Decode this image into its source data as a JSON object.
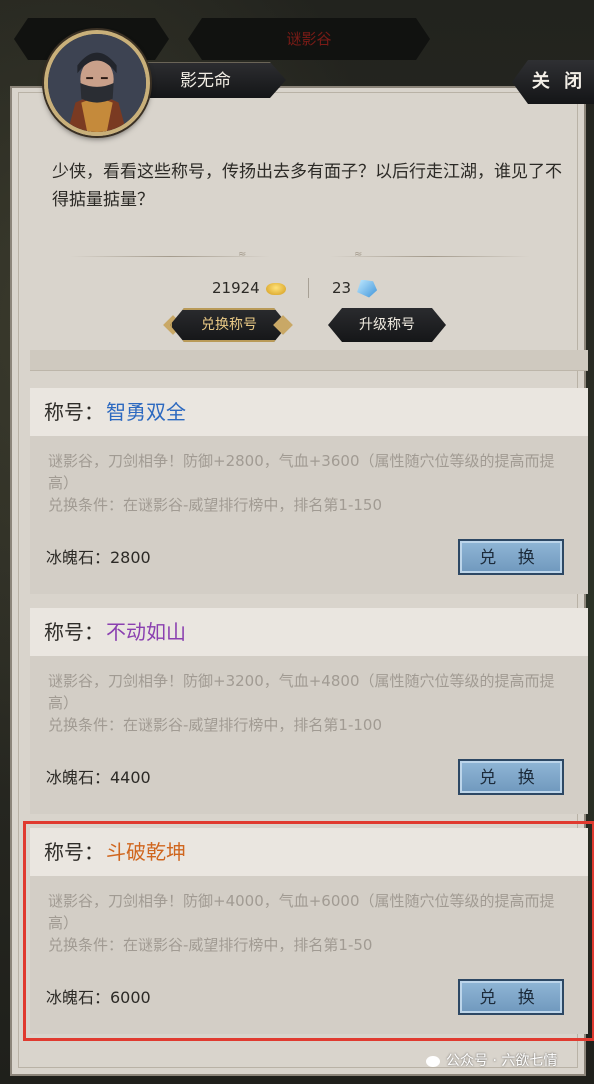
{
  "top_tabs": {
    "left": "",
    "middle": "谜影谷"
  },
  "speaker": {
    "name": "影无命"
  },
  "close_label": "关 闭",
  "dialog_text": "少侠，看看这些称号，传扬出去多有面子？以后行走江湖，谁见了不得掂量掂量？",
  "currencies": {
    "gold": {
      "amount": "21924",
      "icon": "gold-ingot-icon"
    },
    "ice": {
      "amount": "23",
      "icon": "ice-crystal-icon"
    }
  },
  "tabs": [
    {
      "label": "兑换称号",
      "active": true
    },
    {
      "label": "升级称号",
      "active": false
    }
  ],
  "title_prefix": "称号：",
  "cards": [
    {
      "name": "智勇双全",
      "name_color": "#2c69c0",
      "description": "谜影谷，刀剑相争！防御+2800，气血+3600（属性随穴位等级的提高而提高）",
      "condition": "兑换条件：在谜影谷-威望排行榜中，排名第1-150",
      "cost": "冰魄石：2800",
      "button": "兑 换",
      "highlighted": false
    },
    {
      "name": "不动如山",
      "name_color": "#8a3fb0",
      "description": "谜影谷，刀剑相争！防御+3200，气血+4800（属性随穴位等级的提高而提高）",
      "condition": "兑换条件：在谜影谷-威望排行榜中，排名第1-100",
      "cost": "冰魄石：4400",
      "button": "兑 换",
      "highlighted": false
    },
    {
      "name": "斗破乾坤",
      "name_color": "#d0661e",
      "description": "谜影谷，刀剑相争！防御+4000，气血+6000（属性随穴位等级的提高而提高）",
      "condition": "兑换条件：在谜影谷-威望排行榜中，排名第1-50",
      "cost": "冰魄石：6000",
      "button": "兑 换",
      "highlighted": true
    }
  ],
  "watermark": "公众号 · 六欲七情",
  "highlight_color": "#e03a2f"
}
